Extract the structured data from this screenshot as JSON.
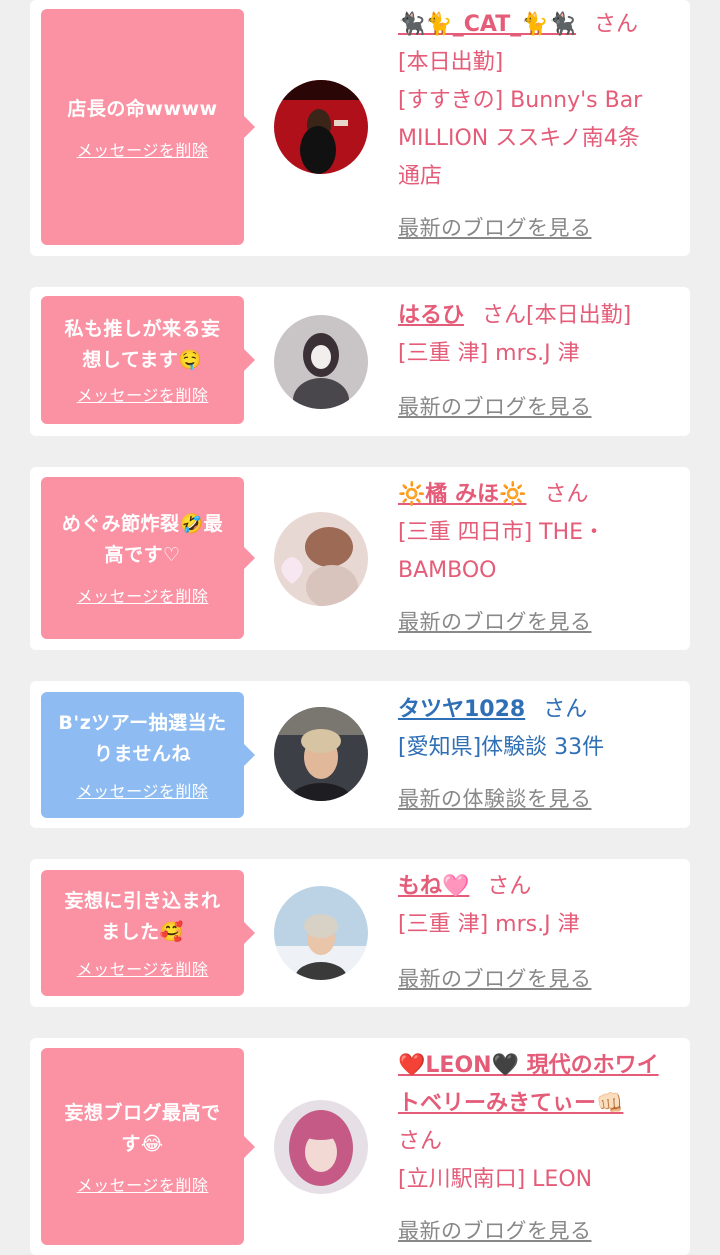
{
  "delete_label": "メッセージを削除",
  "san": "さん",
  "cards": [
    {
      "message_lines": [
        "店長の命wwww"
      ],
      "name": "🐈‍⬛🐈_CAT_🐈🐈‍⬛",
      "details": [
        "[本日出勤]",
        "[すすきの] Bunny's Bar",
        "MILLION ススキノ南4条",
        "通店"
      ],
      "link": "最新のブログを見る",
      "bubble_color": "pink",
      "avatar_desc": "woman-in-black-dress-red-background"
    },
    {
      "message_lines": [
        "私も推しが来る妄",
        "想してます🤤"
      ],
      "name": "はるひ",
      "name_suffix": "さん[本日出勤]",
      "details": [
        "[三重 津] mrs.J 津"
      ],
      "link": "最新のブログを見る",
      "bubble_color": "pink",
      "avatar_desc": "woman-with-mask-street"
    },
    {
      "message_lines": [
        "めぐみ節炸裂🤣最",
        "高です♡"
      ],
      "name": "🔆橘 みほ🔆",
      "details": [
        "[三重 四日市] THE・",
        "BAMBOO"
      ],
      "link": "最新のブログを見る",
      "bubble_color": "pink",
      "avatar_desc": "woman-hair-updo"
    },
    {
      "message_lines": [
        "B'zツアー抽選当た",
        "りませんね"
      ],
      "name": "タツヤ1028",
      "details": [
        "[愛知県]体験談 33件"
      ],
      "link": "最新の体験談を見る",
      "bubble_color": "blue",
      "avatar_desc": "man-blond-hair-gym"
    },
    {
      "message_lines": [
        "妄想に引き込まれ",
        "ました🥰"
      ],
      "name": "もね🩷",
      "details": [
        "[三重 津] mrs.J 津"
      ],
      "link": "最新のブログを見る",
      "bubble_color": "pink",
      "avatar_desc": "woman-knit-hat-snow"
    },
    {
      "message_lines": [
        "妄想ブログ最高で",
        "す😂"
      ],
      "name": "❤️LEON🖤 現代のホワイ",
      "name_line2": "トベリーみきてぃー👊🏻",
      "details": [
        "[立川駅南口] LEON"
      ],
      "san_on_own_line": true,
      "link": "最新のブログを見る",
      "bubble_color": "pink",
      "avatar_desc": "woman-pink-hair"
    }
  ]
}
